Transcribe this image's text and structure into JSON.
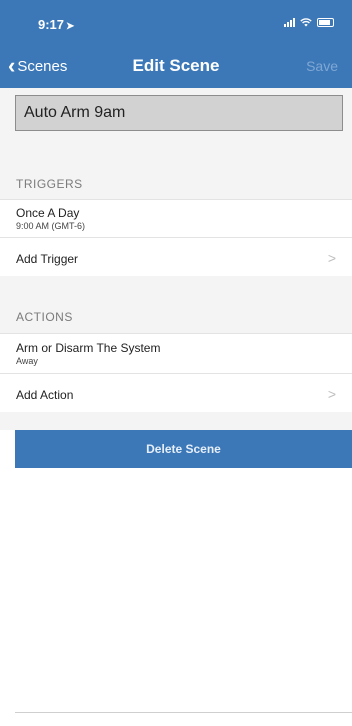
{
  "status": {
    "time": "9:17",
    "location_glyph": "➤"
  },
  "nav": {
    "back_label": "Scenes",
    "title": "Edit Scene",
    "save_label": "Save"
  },
  "scene_name": "Auto Arm 9am",
  "triggers": {
    "header": "TRIGGERS",
    "items": [
      {
        "title": "Once A Day",
        "subtitle": "9:00 AM (GMT-6)"
      }
    ],
    "add_label": "Add Trigger"
  },
  "actions": {
    "header": "ACTIONS",
    "items": [
      {
        "title": "Arm or Disarm The System",
        "subtitle": "Away"
      }
    ],
    "add_label": "Add Action"
  },
  "delete_label": "Delete Scene",
  "colors": {
    "brand": "#3c78b8",
    "background": "#f4f4f4"
  }
}
